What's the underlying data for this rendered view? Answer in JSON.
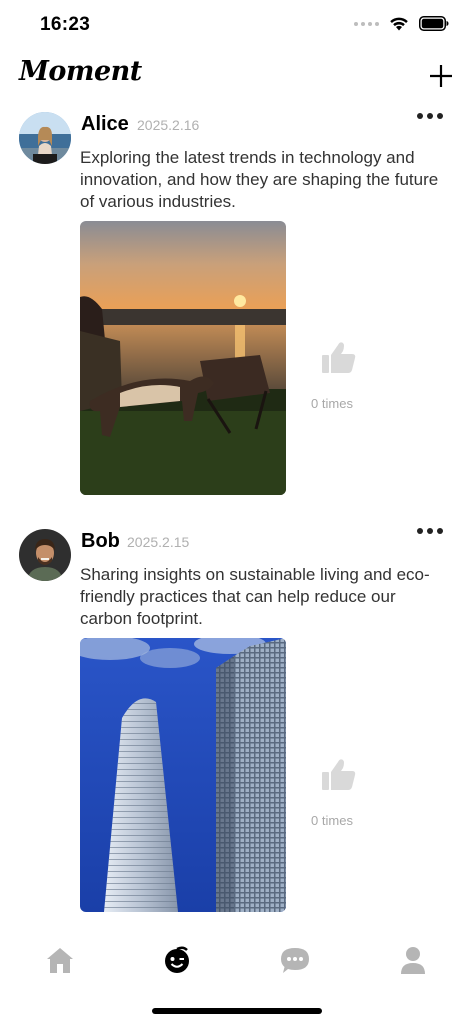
{
  "status_bar": {
    "time": "16:23"
  },
  "header": {
    "title": "Moment"
  },
  "posts": [
    {
      "author": "Alice",
      "date": "2025.2.16",
      "text": "Exploring the latest trends in technology and innovation, and how they are shaping the future of various industries.",
      "likes_label": "0 times"
    },
    {
      "author": "Bob",
      "date": "2025.2.15",
      "text": "Sharing insights on sustainable living and eco-friendly practices that can help reduce our carbon footprint.",
      "likes_label": "0 times"
    }
  ],
  "tab_bar": {
    "active_tab": "moment",
    "tabs": [
      "home",
      "moment",
      "messages",
      "profile"
    ]
  },
  "colors": {
    "active_icon": "#000000",
    "inactive_icon": "#b5b5b5",
    "like_icon": "#d9d9d9"
  }
}
